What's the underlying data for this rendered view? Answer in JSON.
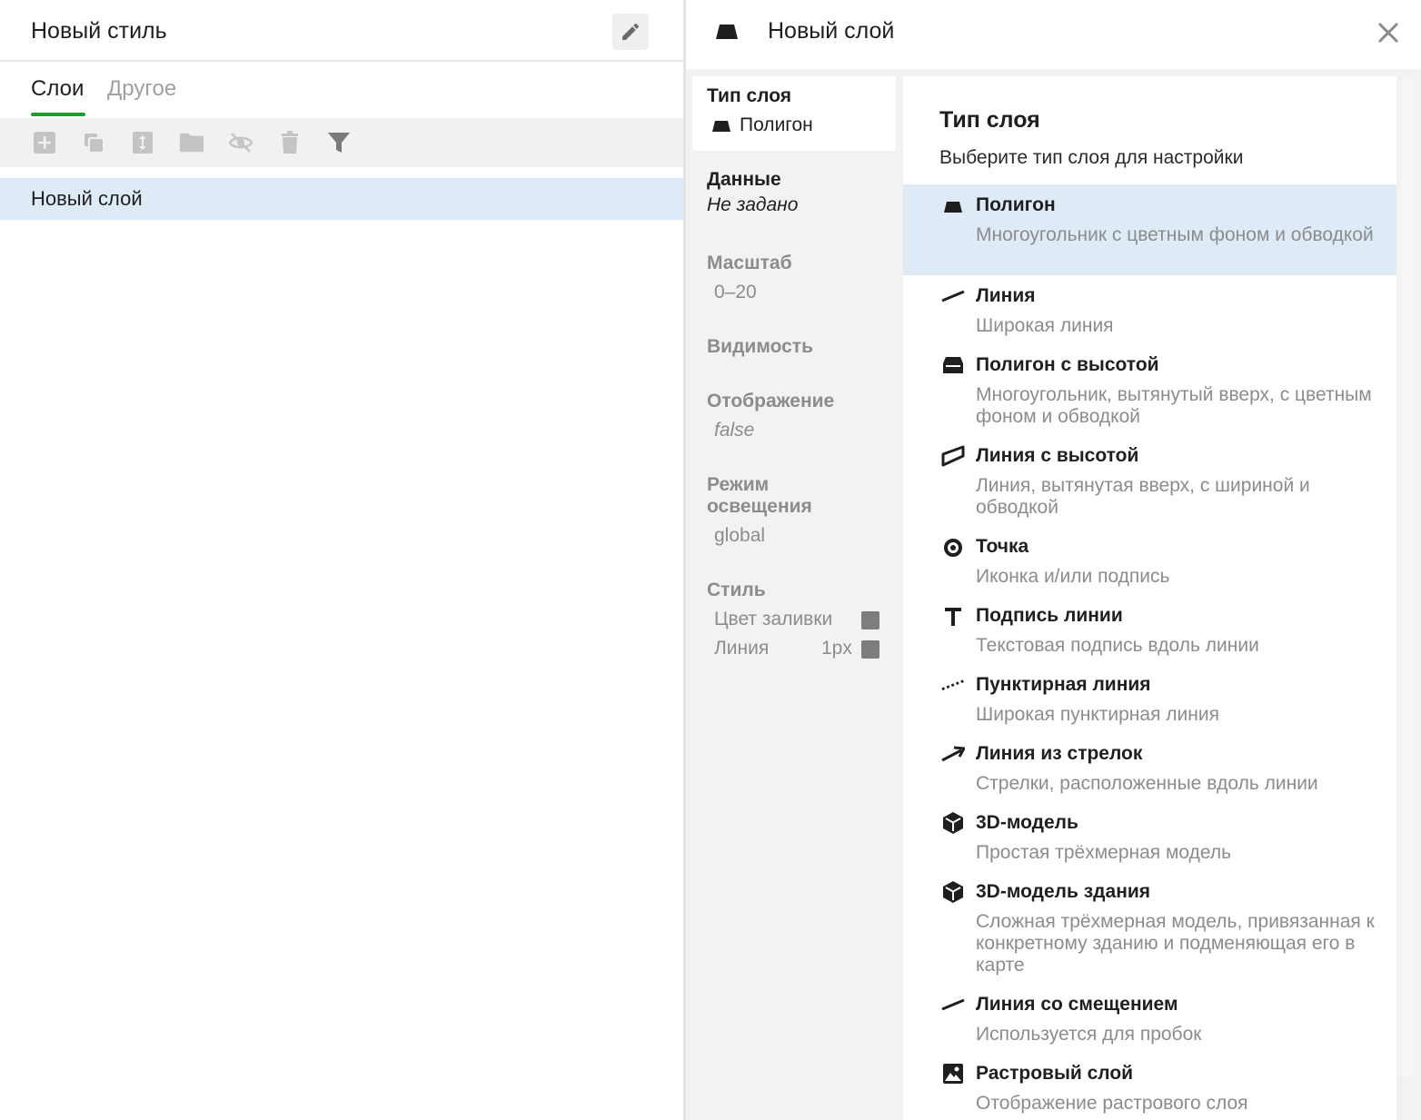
{
  "left": {
    "title": "Новый стиль",
    "tabs": [
      {
        "label": "Слои"
      },
      {
        "label": "Другое"
      }
    ],
    "layers": [
      {
        "label": "Новый слой"
      }
    ]
  },
  "right": {
    "title": "Новый слой",
    "nav": {
      "type_label": "Тип слоя",
      "type_value": "Полигон",
      "data_label": "Данные",
      "data_value": "Не задано",
      "scale_label": "Масштаб",
      "scale_value": "0–20",
      "visibility_label": "Видимость",
      "display_label": "Отображение",
      "display_value": "false",
      "light_label_1": "Режим",
      "light_label_2": "освещения",
      "light_value": "global",
      "style_label": "Стиль",
      "fill_label": "Цвет заливки",
      "line_label": "Линия",
      "line_value": "1px"
    },
    "content": {
      "title": "Тип слоя",
      "subtitle": "Выберите тип слоя для настройки",
      "options": [
        {
          "title": "Полигон",
          "desc": "Многоугольник с цветным фоном и обводкой",
          "icon": "polygon-icon"
        },
        {
          "title": "Линия",
          "desc": "Широкая линия",
          "icon": "line-icon"
        },
        {
          "title": "Полигон с высотой",
          "desc": "Многоугольник, вытянутый вверх, с цветным фоном и обводкой",
          "icon": "extruded-polygon-icon"
        },
        {
          "title": "Линия с высотой",
          "desc": "Линия, вытянутая вверх, с шириной и обводкой",
          "icon": "extruded-line-icon"
        },
        {
          "title": "Точка",
          "desc": "Иконка и/или подпись",
          "icon": "point-icon"
        },
        {
          "title": "Подпись линии",
          "desc": "Текстовая подпись вдоль линии",
          "icon": "text-icon"
        },
        {
          "title": "Пунктирная линия",
          "desc": "Широкая пунктирная линия",
          "icon": "dashed-line-icon"
        },
        {
          "title": "Линия из стрелок",
          "desc": "Стрелки, расположенные вдоль линии",
          "icon": "arrow-line-icon"
        },
        {
          "title": "3D-модель",
          "desc": "Простая трёхмерная модель",
          "icon": "cube-icon"
        },
        {
          "title": "3D-модель здания",
          "desc": "Сложная трёхмерная модель, привязанная к конкретному зданию и подменяющая его в карте",
          "icon": "building-cube-icon"
        },
        {
          "title": "Линия со смещением",
          "desc": "Используется для пробок",
          "icon": "offset-line-icon"
        },
        {
          "title": "Растровый слой",
          "desc": "Отображение растрового слоя",
          "icon": "raster-icon"
        }
      ]
    }
  },
  "colors": {
    "accent": "#1aa02a",
    "selected": "#deebf6",
    "swatch": "#7d7d7d"
  }
}
